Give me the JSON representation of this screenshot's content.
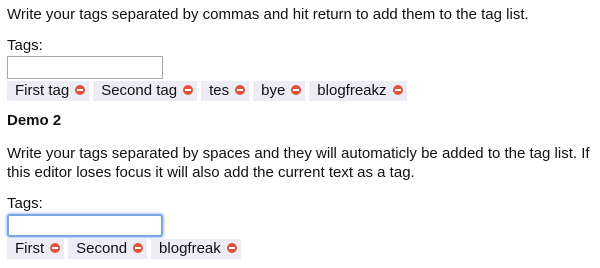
{
  "demo1": {
    "description": "Write your tags separated by commas and hit return to add them to the tag list.",
    "label": "Tags:",
    "input_value": "",
    "tags": [
      "First tag",
      "Second tag",
      "tes",
      "bye",
      "blogfreakz"
    ]
  },
  "demo2": {
    "heading": "Demo 2",
    "description": "Write your tags separated by spaces and they will automaticly be added to the tag list. If this editor loses focus it will also add the current text as a tag.",
    "label": "Tags:",
    "input_value": "",
    "tags": [
      "First",
      "Second",
      "blogfreak"
    ]
  },
  "icons": {
    "remove": "remove-circle-icon"
  },
  "colors": {
    "tag_background": "#ececf4",
    "remove_icon": "#e0523a",
    "focus_ring": "#7aa7de"
  }
}
